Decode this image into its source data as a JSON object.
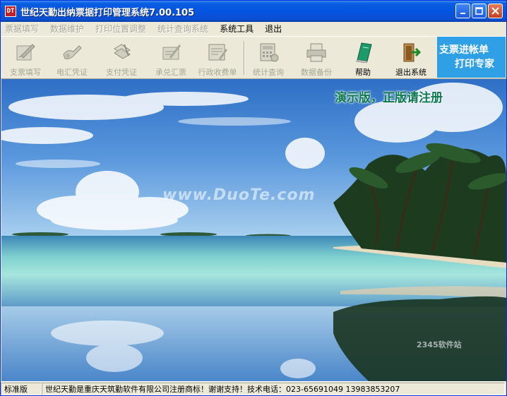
{
  "window": {
    "title": "世纪天勤出纳票据打印管理系统7.00.105",
    "app_icon": "DT"
  },
  "menubar": {
    "items": [
      {
        "label": "票据填写",
        "enabled": false
      },
      {
        "label": "数据维护",
        "enabled": false
      },
      {
        "label": "打印位置调整",
        "enabled": false
      },
      {
        "label": "统计查询系统",
        "enabled": false
      },
      {
        "label": "系统工具",
        "enabled": true
      },
      {
        "label": "退出",
        "enabled": true
      }
    ]
  },
  "toolbar": {
    "buttons": [
      {
        "label": "支票填写",
        "icon": "pen-paper-icon",
        "enabled": false
      },
      {
        "label": "电汇凭证",
        "icon": "hand-write-icon",
        "enabled": false
      },
      {
        "label": "支付凭证",
        "icon": "document-stack-icon",
        "enabled": false
      },
      {
        "label": "承兑汇票",
        "icon": "pen-check-icon",
        "enabled": false
      },
      {
        "label": "行政收费单",
        "icon": "form-icon",
        "enabled": false
      },
      {
        "label": "统计查询",
        "icon": "calculator-icon",
        "enabled": false
      },
      {
        "label": "数据备份",
        "icon": "printer-icon",
        "enabled": false
      },
      {
        "label": "帮助",
        "icon": "book-icon",
        "enabled": true
      },
      {
        "label": "退出系统",
        "icon": "exit-door-icon",
        "enabled": true
      }
    ]
  },
  "promo": {
    "line1": "支票进帐单",
    "line2": "打印专家"
  },
  "scene": {
    "demo_notice": "演示版，正版请注册",
    "watermark": "www.DuoTe.com",
    "corner_watermark": "2345软件站"
  },
  "statusbar": {
    "edition": "标准版",
    "message": "世纪天勤是重庆天筑勤软件有限公司注册商标！谢谢支持！技术电话：023-65691049   13983853207"
  },
  "colors": {
    "titlebar": "#0554e0",
    "promo_bg": "#2fa0e6",
    "demo_text": "#0e7a50"
  }
}
